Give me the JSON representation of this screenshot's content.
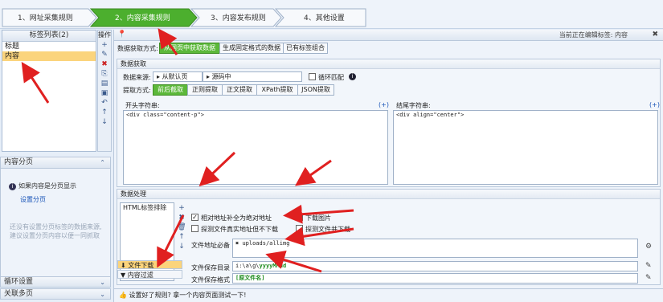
{
  "wizard": {
    "steps": [
      {
        "label": "1、网址采集规则",
        "active": false
      },
      {
        "label": "2、内容采集规则",
        "active": true
      },
      {
        "label": "3、内容发布规则",
        "active": false
      },
      {
        "label": "4、其他设置",
        "active": false
      }
    ]
  },
  "tag_list": {
    "title": "标签列表(2)",
    "toolbar_title": "操作",
    "items": [
      {
        "label": "标题",
        "selected": false
      },
      {
        "label": "内容",
        "selected": true
      }
    ],
    "toolbar_icons": [
      "add-icon",
      "edit-icon",
      "delete-icon",
      "copy-icon",
      "paste-icon",
      "lock-icon",
      "undo-icon",
      "move-up-icon",
      "move-down-icon"
    ]
  },
  "paging": {
    "title": "内容分页",
    "note": "如果内容是分页显示",
    "link": "设置分页",
    "faint_text": "还没有设置分页标签的数据来源, 建议设置分页内容以便一同抓取"
  },
  "collapsed": {
    "loop": "循环设置",
    "related": "关联多页"
  },
  "main": {
    "editing": "当前正在编辑标签: 内容",
    "method_label": "数据获取方式:",
    "methods": [
      {
        "label": "从网页中获取数据",
        "on": true
      },
      {
        "label": "生成固定格式的数据",
        "on": false
      },
      {
        "label": "已有标签组合",
        "on": false
      }
    ],
    "fetch_group": {
      "title": "数据获取",
      "source_label": "数据来源:",
      "source_a": "从默认页",
      "source_b": "源码中",
      "loop_match": "循环匹配",
      "extract_label": "提取方式:",
      "extract_modes": [
        {
          "label": "前后截取",
          "on": true
        },
        {
          "label": "正则提取",
          "on": false
        },
        {
          "label": "正文提取",
          "on": false
        },
        {
          "label": "XPath提取",
          "on": false
        },
        {
          "label": "JSON提取",
          "on": false
        }
      ],
      "start_label": "开头字符串:",
      "end_label": "结尾字符串:",
      "start_value": "<div class=\"content-p\">",
      "end_value": "<div align=\"center\">",
      "plus": "(+)"
    },
    "process_group": {
      "title": "数据处理",
      "rules": [
        "HTML标签排除"
      ],
      "tabs": [
        {
          "label": "文件下载",
          "on": true
        },
        {
          "label": "内容过滤",
          "on": false
        }
      ],
      "options": [
        {
          "label": "相对地址补全为绝对地址",
          "checked": true
        },
        {
          "label": "下载图片",
          "checked": true
        },
        {
          "label": "探测文件真实地址但不下载",
          "checked": false
        },
        {
          "label": "探测文件并下载",
          "checked": false
        }
      ],
      "prefix_label": "文件地址必备",
      "prefix_value": "uploads/allimg",
      "save_dir_label": "文件保存目录",
      "save_dir_value": "i:\\a\\g\\",
      "save_dir_green": "yyyyMMdd",
      "save_fmt_label": "文件保存格式",
      "save_fmt_value": "[原文件名]"
    },
    "footer": "设置好了规则? 拿一个内容页面测试一下!"
  },
  "colors": {
    "accent_green": "#5cb83a",
    "active_step": "#4caf2e",
    "selected_row": "#fbd47c",
    "annotation_red": "#e02020"
  }
}
